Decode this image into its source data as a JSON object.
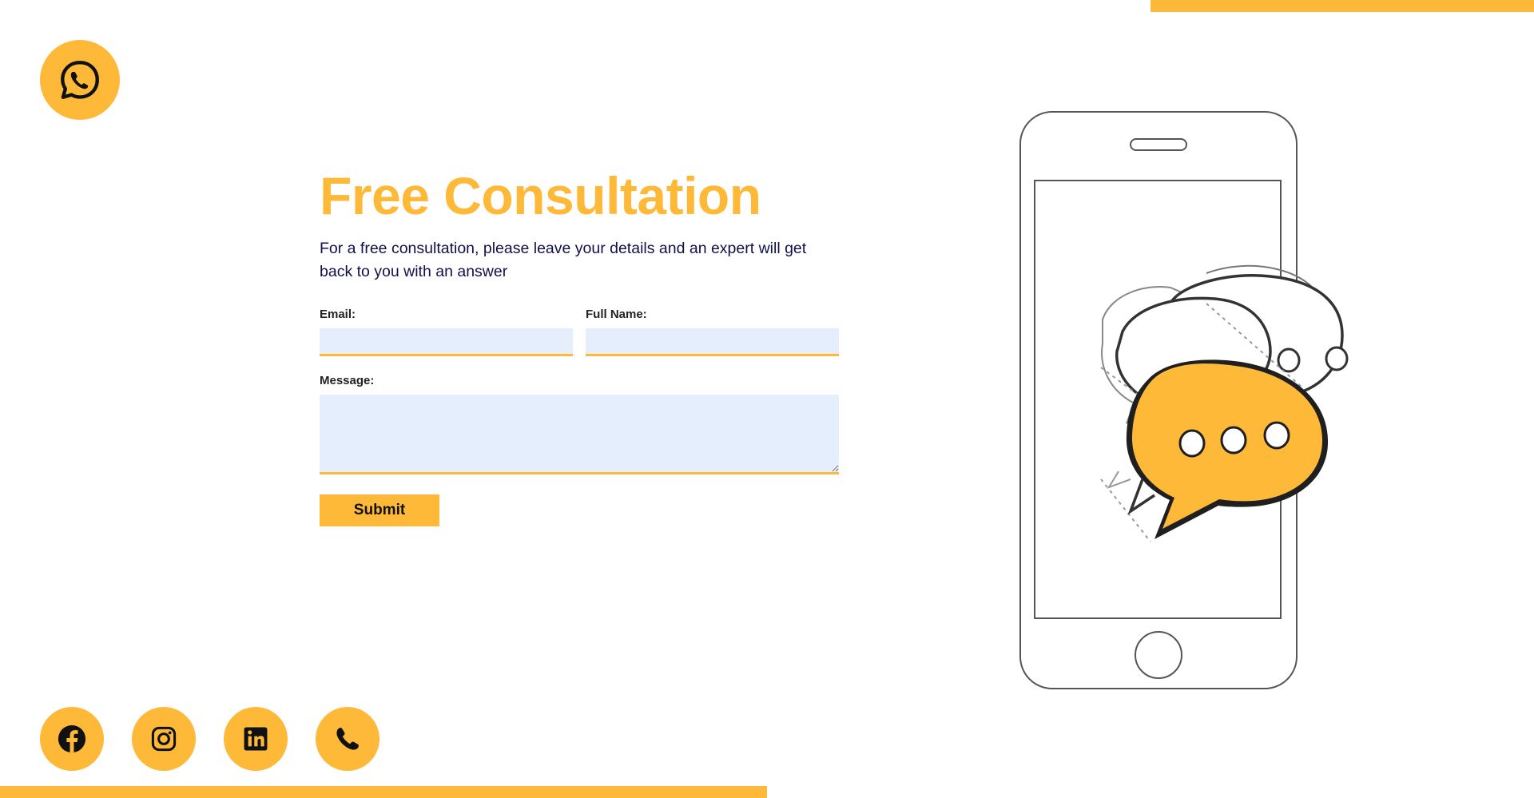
{
  "colors": {
    "accent": "#FDB937",
    "input_bg": "#E4EEFD",
    "subtitle_text": "#10104a"
  },
  "whatsapp": {
    "icon": "whatsapp-icon"
  },
  "form": {
    "title": "Free Consultation",
    "subtitle": "For a free consultation, please leave your details and an expert will get back to you with an answer",
    "email_label": "Email:",
    "email_value": "",
    "fullname_label": "Full Name:",
    "fullname_value": "",
    "message_label": "Message:",
    "message_value": "",
    "submit_label": "Submit"
  },
  "socials": [
    {
      "icon": "facebook-icon"
    },
    {
      "icon": "instagram-icon"
    },
    {
      "icon": "linkedin-icon"
    },
    {
      "icon": "phone-icon"
    }
  ],
  "illustration": {
    "subject": "phone-with-chat-bubbles-illustration"
  }
}
